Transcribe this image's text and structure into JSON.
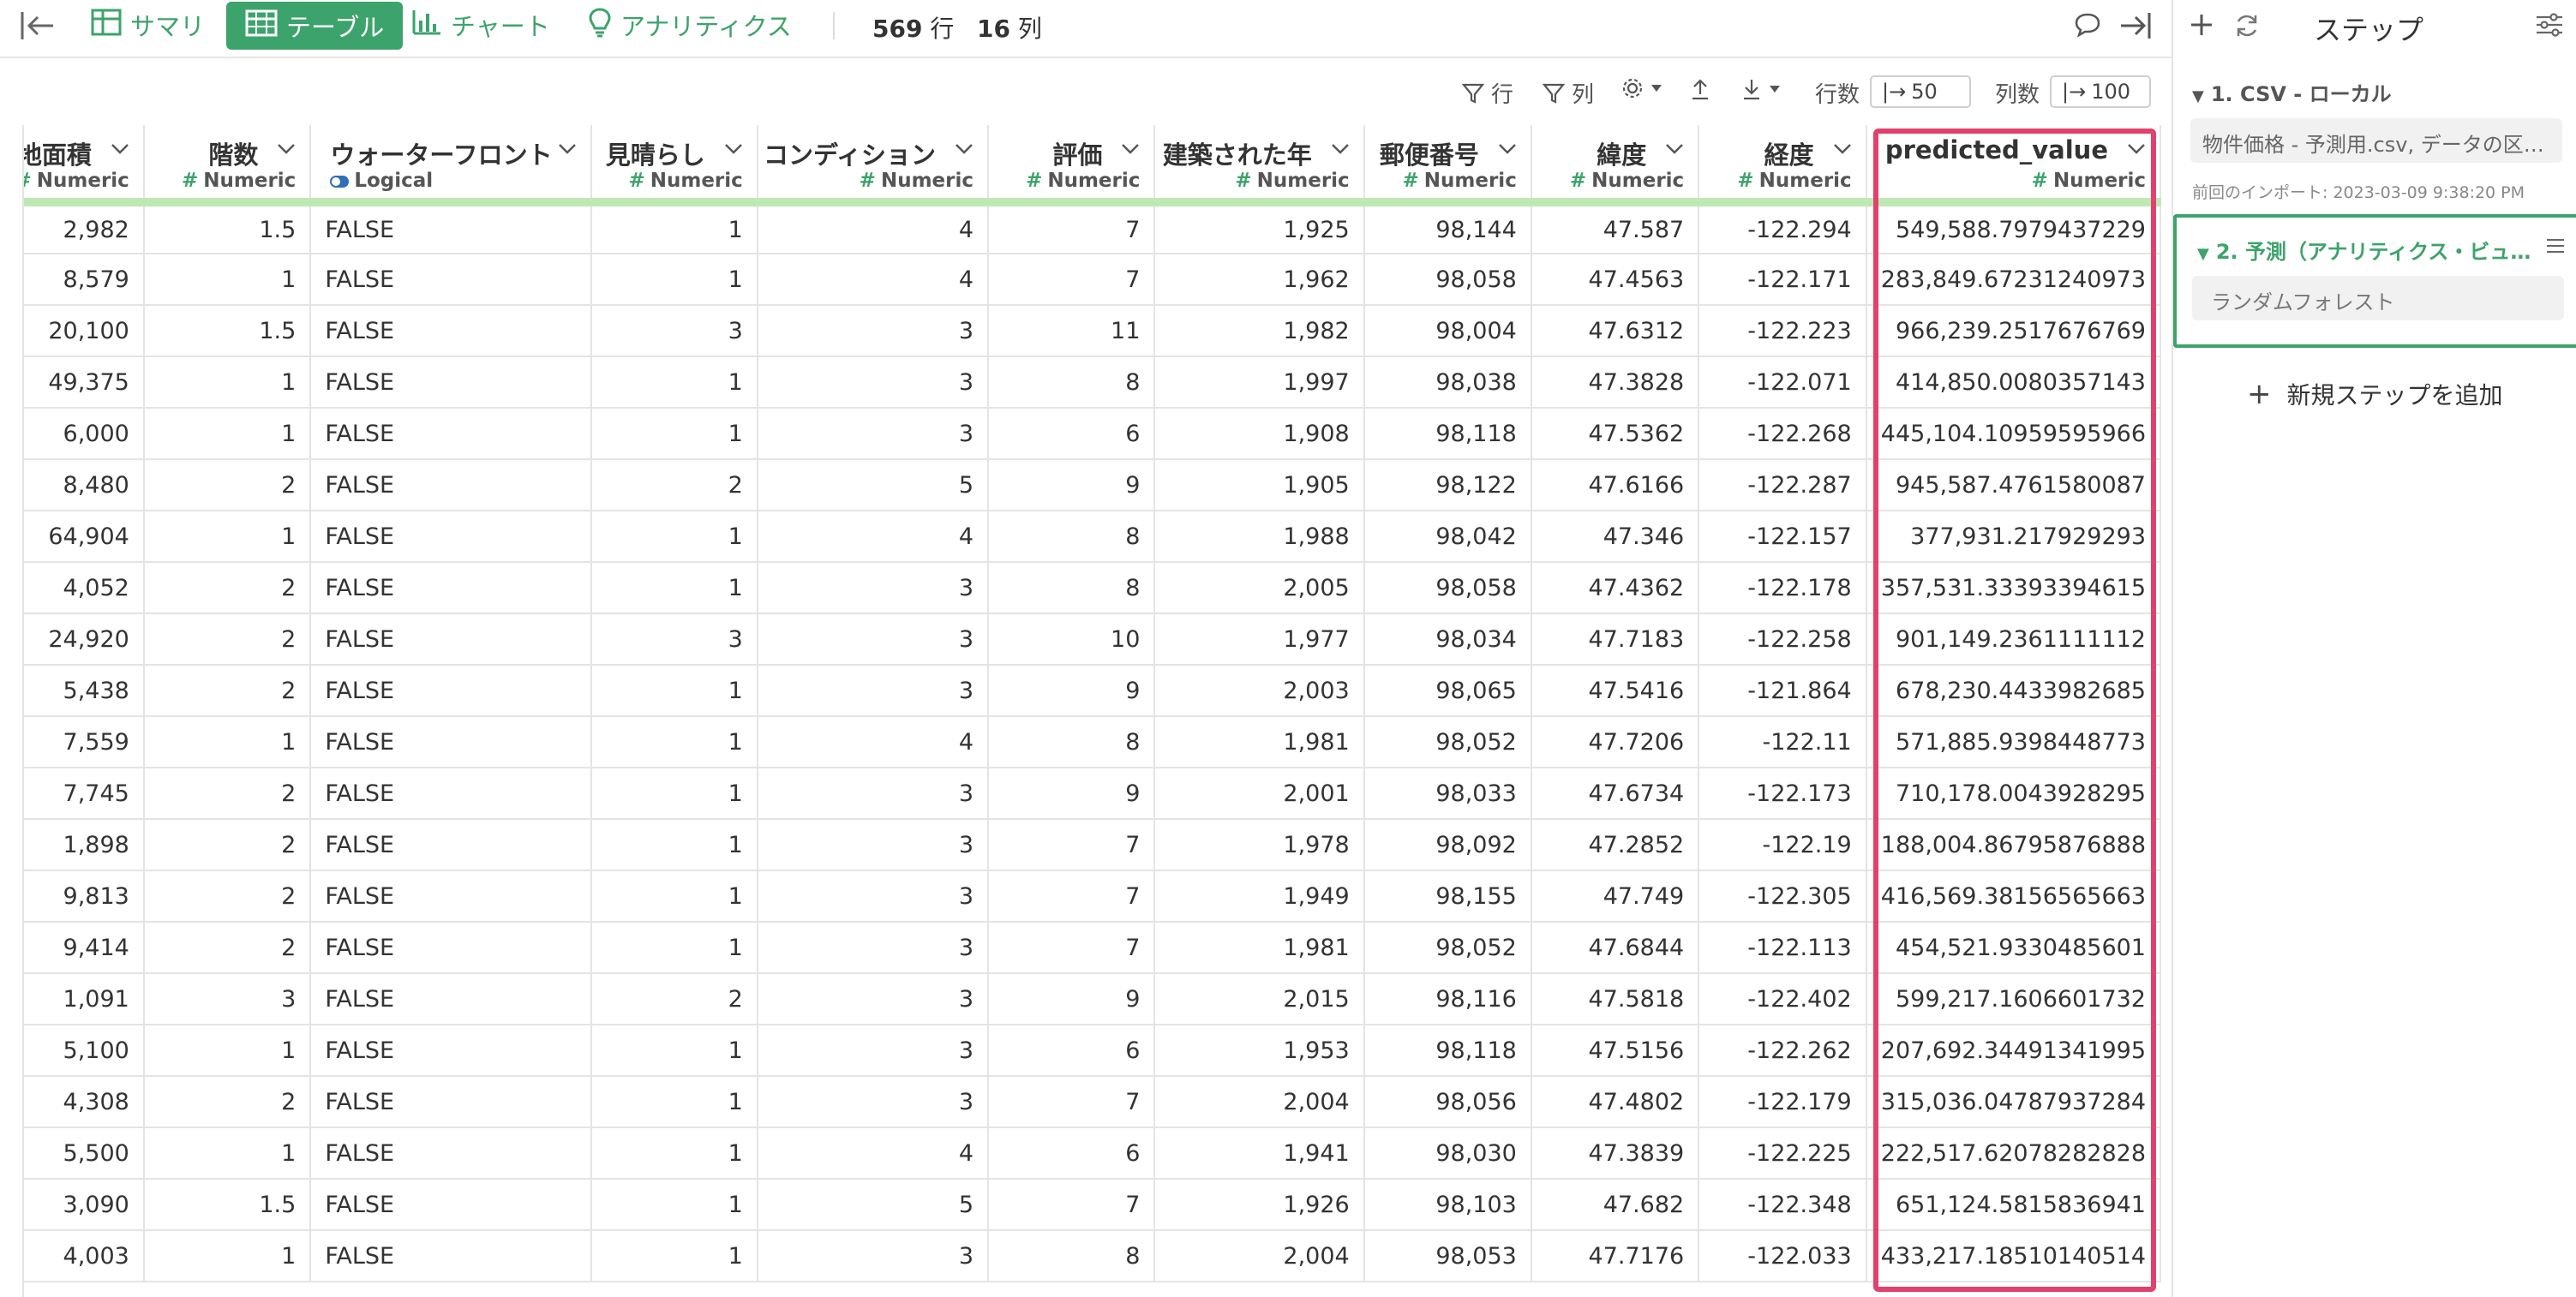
{
  "toolbar": {
    "tabs": [
      {
        "label": "サマリ",
        "icon": "summary-grid-icon"
      },
      {
        "label": "テーブル",
        "icon": "table-icon"
      },
      {
        "label": "チャート",
        "icon": "bar-chart-icon"
      },
      {
        "label": "アナリティクス",
        "icon": "lightbulb-icon"
      }
    ],
    "row_count_value": "569",
    "row_count_unit": "行",
    "col_count_value": "16",
    "col_count_unit": "列",
    "accent_color": "#3da36c"
  },
  "subtoolbar": {
    "row_filter_label": "行",
    "col_filter_label": "列",
    "rows_label": "行数",
    "rows_value": "50",
    "cols_label": "列数",
    "cols_value": "100"
  },
  "table": {
    "columns": [
      {
        "name": "地面積",
        "type": "Numeric"
      },
      {
        "name": "階数",
        "type": "Numeric"
      },
      {
        "name": "ウォーターフロント",
        "type": "Logical"
      },
      {
        "name": "見晴らし",
        "type": "Numeric"
      },
      {
        "name": "コンディション",
        "type": "Numeric"
      },
      {
        "name": "評価",
        "type": "Numeric"
      },
      {
        "name": "建築された年",
        "type": "Numeric"
      },
      {
        "name": "郵便番号",
        "type": "Numeric"
      },
      {
        "name": "緯度",
        "type": "Numeric"
      },
      {
        "name": "経度",
        "type": "Numeric"
      },
      {
        "name": "predicted_value",
        "type": "Numeric"
      }
    ],
    "rows": [
      [
        "2,982",
        "1.5",
        "FALSE",
        "1",
        "4",
        "7",
        "1,925",
        "98,144",
        "47.587",
        "-122.294",
        "549,588.7979437229"
      ],
      [
        "8,579",
        "1",
        "FALSE",
        "1",
        "4",
        "7",
        "1,962",
        "98,058",
        "47.4563",
        "-122.171",
        "283,849.67231240973"
      ],
      [
        "20,100",
        "1.5",
        "FALSE",
        "3",
        "3",
        "11",
        "1,982",
        "98,004",
        "47.6312",
        "-122.223",
        "966,239.2517676769"
      ],
      [
        "49,375",
        "1",
        "FALSE",
        "1",
        "3",
        "8",
        "1,997",
        "98,038",
        "47.3828",
        "-122.071",
        "414,850.0080357143"
      ],
      [
        "6,000",
        "1",
        "FALSE",
        "1",
        "3",
        "6",
        "1,908",
        "98,118",
        "47.5362",
        "-122.268",
        "445,104.10959595966"
      ],
      [
        "8,480",
        "2",
        "FALSE",
        "2",
        "5",
        "9",
        "1,905",
        "98,122",
        "47.6166",
        "-122.287",
        "945,587.4761580087"
      ],
      [
        "64,904",
        "1",
        "FALSE",
        "1",
        "4",
        "8",
        "1,988",
        "98,042",
        "47.346",
        "-122.157",
        "377,931.217929293"
      ],
      [
        "4,052",
        "2",
        "FALSE",
        "1",
        "3",
        "8",
        "2,005",
        "98,058",
        "47.4362",
        "-122.178",
        "357,531.33393394615"
      ],
      [
        "24,920",
        "2",
        "FALSE",
        "3",
        "3",
        "10",
        "1,977",
        "98,034",
        "47.7183",
        "-122.258",
        "901,149.2361111112"
      ],
      [
        "5,438",
        "2",
        "FALSE",
        "1",
        "3",
        "9",
        "2,003",
        "98,065",
        "47.5416",
        "-121.864",
        "678,230.4433982685"
      ],
      [
        "7,559",
        "1",
        "FALSE",
        "1",
        "4",
        "8",
        "1,981",
        "98,052",
        "47.7206",
        "-122.11",
        "571,885.9398448773"
      ],
      [
        "7,745",
        "2",
        "FALSE",
        "1",
        "3",
        "9",
        "2,001",
        "98,033",
        "47.6734",
        "-122.173",
        "710,178.0043928295"
      ],
      [
        "1,898",
        "2",
        "FALSE",
        "1",
        "3",
        "7",
        "1,978",
        "98,092",
        "47.2852",
        "-122.19",
        "188,004.86795876888"
      ],
      [
        "9,813",
        "2",
        "FALSE",
        "1",
        "3",
        "7",
        "1,949",
        "98,155",
        "47.749",
        "-122.305",
        "416,569.38156565663"
      ],
      [
        "9,414",
        "2",
        "FALSE",
        "1",
        "3",
        "7",
        "1,981",
        "98,052",
        "47.6844",
        "-122.113",
        "454,521.9330485601"
      ],
      [
        "1,091",
        "3",
        "FALSE",
        "2",
        "3",
        "9",
        "2,015",
        "98,116",
        "47.5818",
        "-122.402",
        "599,217.1606601732"
      ],
      [
        "5,100",
        "1",
        "FALSE",
        "1",
        "3",
        "6",
        "1,953",
        "98,118",
        "47.5156",
        "-122.262",
        "207,692.34491341995"
      ],
      [
        "4,308",
        "2",
        "FALSE",
        "1",
        "3",
        "7",
        "2,004",
        "98,056",
        "47.4802",
        "-122.179",
        "315,036.04787937284"
      ],
      [
        "5,500",
        "1",
        "FALSE",
        "1",
        "4",
        "6",
        "1,941",
        "98,030",
        "47.3839",
        "-122.225",
        "222,517.62078282828"
      ],
      [
        "3,090",
        "1.5",
        "FALSE",
        "1",
        "5",
        "7",
        "1,926",
        "98,103",
        "47.682",
        "-122.348",
        "651,124.5815836941"
      ],
      [
        "4,003",
        "1",
        "FALSE",
        "1",
        "3",
        "8",
        "2,004",
        "98,053",
        "47.7176",
        "-122.033",
        "433,217.18510140514"
      ]
    ],
    "highlight_color": "#e2406d"
  },
  "steps_panel": {
    "title": "ステップ",
    "step1": {
      "title": "1. CSV - ローカル",
      "source": "物件価格 - 予測用.csv, データの区…",
      "note": "前回のインポート: 2023-03-09 9:38:20 PM"
    },
    "step2": {
      "title": "2. 予測（アナリティクス・ビュ…",
      "model": "ランダムフォレスト"
    },
    "add_step_label": "新規ステップを追加"
  }
}
